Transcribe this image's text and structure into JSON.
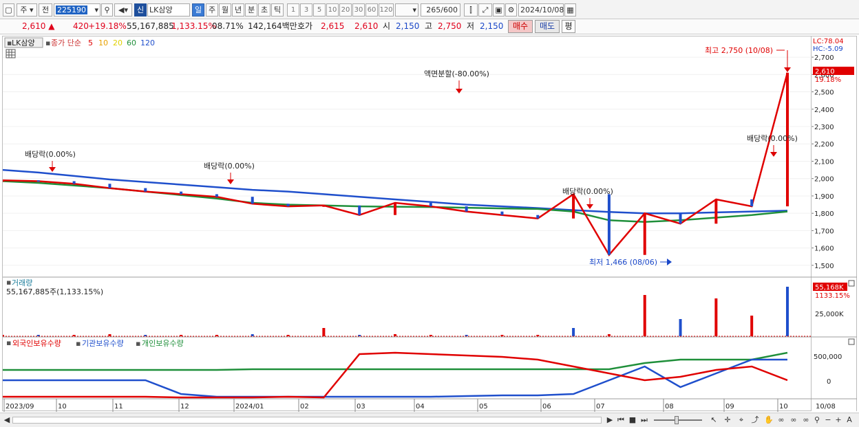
{
  "toolbar": {
    "period_select": "주",
    "prev_label": "전",
    "stock_code": "225190",
    "credit_badge": "신",
    "stock_name": "LK삼양",
    "periods": [
      "일",
      "주",
      "월",
      "년",
      "분",
      "초",
      "틱"
    ],
    "minute_periods": [
      "1",
      "3",
      "5",
      "10",
      "20",
      "30",
      "60",
      "120"
    ],
    "count": "265",
    "count_total": "/600",
    "date": "2024/10/08"
  },
  "quote": {
    "price": "2,610",
    "change": "420",
    "change_pct": "+19.18%",
    "volume": "55,167,885",
    "volume_ratio": "1,133.15%",
    "turnover": "08.71%",
    "amount": "142,164백만",
    "hoga_label": "호가",
    "ask": "2,615",
    "bid": "2,610",
    "open_label": "시",
    "open": "2,150",
    "high_label": "고",
    "high": "2,750",
    "low_label": "저",
    "low": "2,150",
    "buy_button": "매수",
    "sell_button": "매도",
    "eval_button": "평"
  },
  "chart_data": [
    {
      "type": "line",
      "name": "price",
      "legend": {
        "stock": "LK삼양",
        "indicator": "종가 단순",
        "ma_periods": [
          "5",
          "10",
          "20",
          "60",
          "120"
        ],
        "ma_colors": [
          "#e00000",
          "#e8a000",
          "#f0e000",
          "#1f8f3a",
          "#1f4fcc"
        ]
      },
      "y_ticks": [
        "2,700",
        "2,600",
        "2,500",
        "2,400",
        "2,300",
        "2,200",
        "2,100",
        "2,000",
        "1,900",
        "1,800",
        "1,700",
        "1,600",
        "1,500"
      ],
      "ylim": [
        1440,
        2740
      ],
      "lc_label": "LC:78.04",
      "hc_label": "HC:-5.09",
      "last_price": "2,610",
      "last_pct": "19.18%",
      "annotations": {
        "max": "최고 2,750 (10/08)",
        "min": "최저 1,466 (08/06)",
        "split": "액면분할(-80.00%)",
        "dividend_1": "배당락(0.00%)",
        "dividend_2": "배당락(0.00%)",
        "dividend_3": "배당락(0.00%)",
        "dividend_4": "배당락(0.00%)"
      },
      "series": [
        {
          "name": "120",
          "color": "#1f4fcc",
          "values": [
            2050,
            2035,
            2015,
            1995,
            1980,
            1965,
            1950,
            1935,
            1925,
            1910,
            1895,
            1880,
            1865,
            1850,
            1840,
            1830,
            1818,
            1808,
            1800,
            1800,
            1805,
            1810,
            1815
          ]
        },
        {
          "name": "60",
          "color": "#1f8f3a",
          "values": [
            1985,
            1975,
            1960,
            1945,
            1925,
            1905,
            1885,
            1860,
            1850,
            1845,
            1840,
            1838,
            1836,
            1832,
            1828,
            1825,
            1810,
            1760,
            1750,
            1760,
            1775,
            1790,
            1810
          ]
        },
        {
          "name": "close",
          "color": "#e00000",
          "values": [
            1990,
            1985,
            1970,
            1945,
            1925,
            1910,
            1895,
            1855,
            1840,
            1845,
            1790,
            1860,
            1840,
            1810,
            1790,
            1770,
            1910,
            1560,
            1800,
            1740,
            1880,
            1840,
            2610
          ]
        }
      ]
    },
    {
      "type": "bar",
      "name": "volume",
      "title": "거래량",
      "subtitle": "55,167,885주(1,133.15%)",
      "y_tick": "25,000K",
      "last_value": "55,168K",
      "last_pct": "1133.15%"
    },
    {
      "type": "line",
      "name": "holdings",
      "legend": [
        "외국인보유수량",
        "기관보유수량",
        "개인보유수량"
      ],
      "legend_colors": [
        "#e00000",
        "#1f4fcc",
        "#1f8f3a"
      ],
      "y_ticks": [
        "500,000",
        "0"
      ],
      "x_ticks": [
        "2023/09",
        "10",
        "11",
        "12",
        "2024/01",
        "02",
        "03",
        "04",
        "05",
        "06",
        "07",
        "08",
        "09",
        "10"
      ],
      "x_last": "10/08"
    }
  ]
}
